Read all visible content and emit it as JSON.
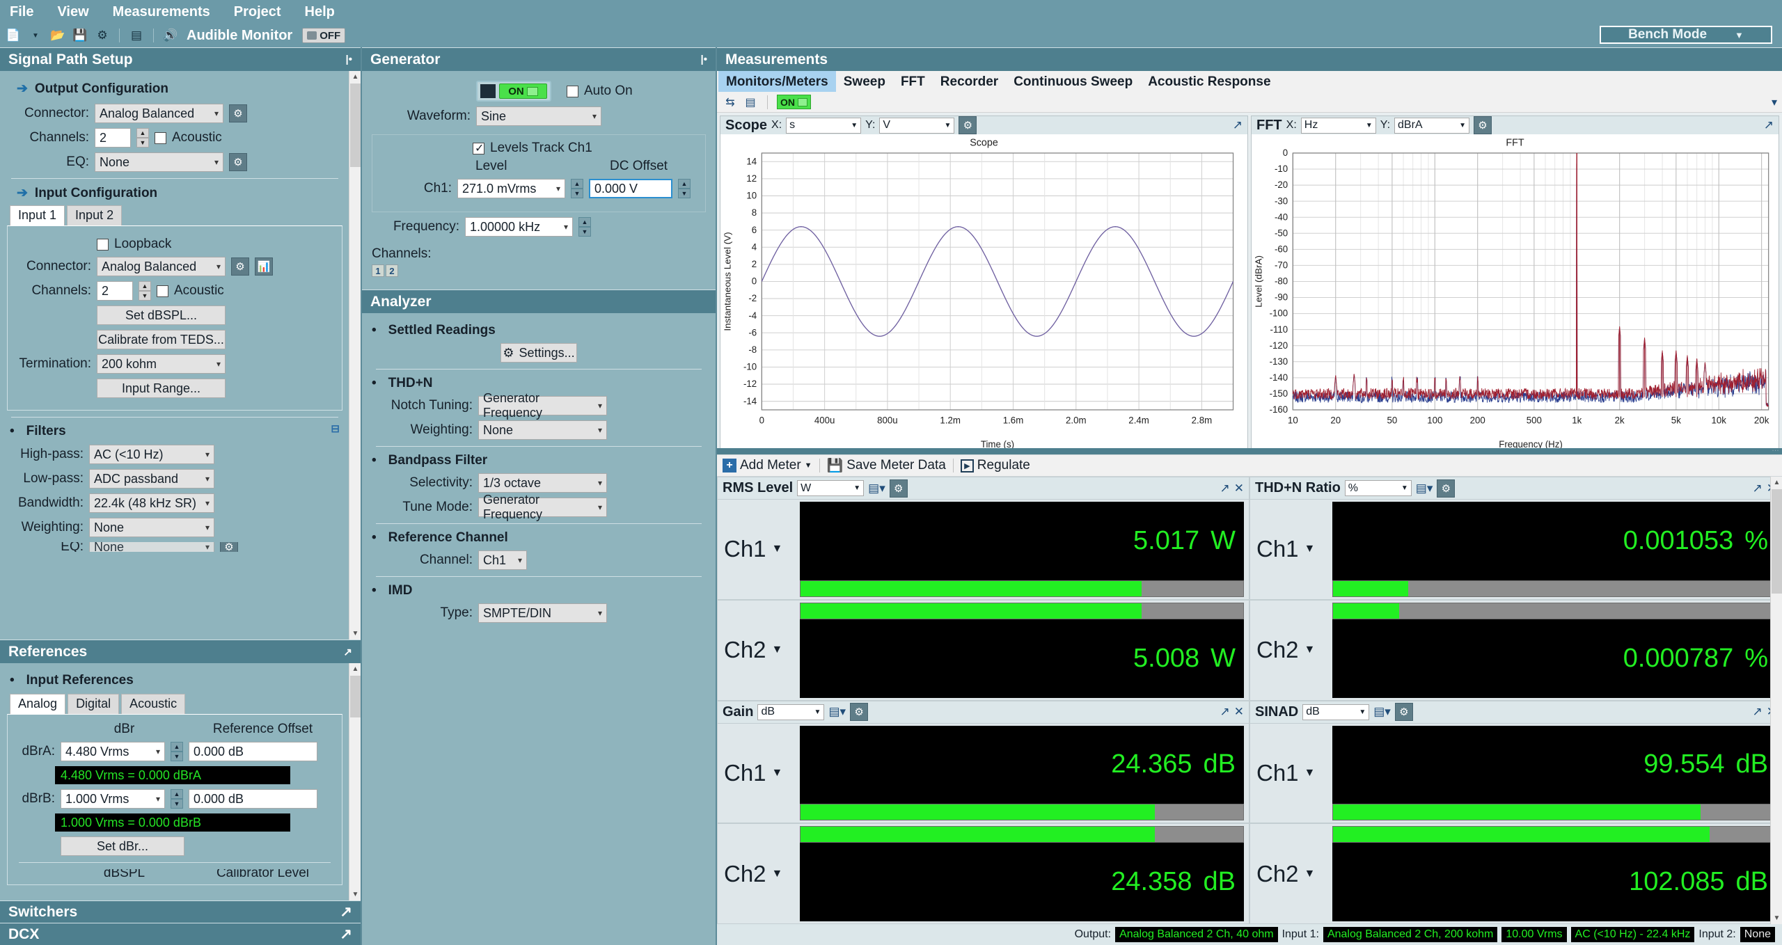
{
  "menu": {
    "items": [
      "File",
      "View",
      "Measurements",
      "Project",
      "Help"
    ]
  },
  "toolbar": {
    "icons": [
      "new-document-icon",
      "open-folder-icon",
      "save-icon",
      "settings-gear-icon",
      "waveform-icon",
      "speaker-icon"
    ],
    "audible_monitor_label": "Audible Monitor",
    "audible_monitor_state": "OFF",
    "bench_mode_label": "Bench Mode"
  },
  "signal_path": {
    "panel_title": "Signal Path Setup",
    "output": {
      "section_title": "Output Configuration",
      "connector_label": "Connector:",
      "connector_value": "Analog Balanced",
      "channels_label": "Channels:",
      "channels_value": "2",
      "acoustic_label": "Acoustic",
      "eq_label": "EQ:",
      "eq_value": "None"
    },
    "input": {
      "section_title": "Input Configuration",
      "tabs": [
        "Input 1",
        "Input 2"
      ],
      "active_tab": "Input 1",
      "loopback_label": "Loopback",
      "connector_label": "Connector:",
      "connector_value": "Analog Balanced",
      "channels_label": "Channels:",
      "channels_value": "2",
      "acoustic_label": "Acoustic",
      "set_dbspl_label": "Set dBSPL...",
      "calibrate_teds_label": "Calibrate from TEDS...",
      "termination_label": "Termination:",
      "termination_value": "200 kohm",
      "input_range_label": "Input Range..."
    },
    "filters": {
      "section_title": "Filters",
      "highpass_label": "High-pass:",
      "highpass_value": "AC (<10 Hz)",
      "lowpass_label": "Low-pass:",
      "lowpass_value": "ADC passband",
      "bandwidth_label": "Bandwidth:",
      "bandwidth_value": "22.4k (48 kHz SR)",
      "weighting_label": "Weighting:",
      "weighting_value": "None",
      "eq_label": "EQ:",
      "eq_value": "None"
    }
  },
  "references": {
    "panel_title": "References",
    "section_title": "Input References",
    "tabs": [
      "Analog",
      "Digital",
      "Acoustic"
    ],
    "active_tab": "Analog",
    "col_dbr": "dBr",
    "col_offset": "Reference Offset",
    "rows": [
      {
        "label": "dBrA:",
        "value": "4.480 Vrms",
        "offset": "0.000 dB",
        "readout": "4.480 Vrms = 0.000 dBrA"
      },
      {
        "label": "dBrB:",
        "value": "1.000 Vrms",
        "offset": "0.000 dB",
        "readout": "1.000 Vrms = 0.000 dBrB"
      }
    ],
    "set_dbr_label": "Set dBr...",
    "footer_col_dbspl": "dBSPL",
    "footer_col_calibrator": "Calibrator Level"
  },
  "bottom_panels": [
    {
      "title": "Switchers"
    },
    {
      "title": "DCX"
    }
  ],
  "generator": {
    "panel_title": "Generator",
    "on_label": "ON",
    "auto_on_label": "Auto On",
    "waveform_label": "Waveform:",
    "waveform_value": "Sine",
    "levels_track_label": "Levels Track Ch1",
    "level_col": "Level",
    "dc_offset_col": "DC Offset",
    "ch1_label": "Ch1:",
    "ch1_level": "271.0 mVrms",
    "ch1_dc_offset": "0.000 V",
    "frequency_label": "Frequency:",
    "frequency_value": "1.00000 kHz",
    "channels_label": "Channels:",
    "channel_buttons": [
      "1",
      "2"
    ]
  },
  "analyzer": {
    "panel_title": "Analyzer",
    "settled_readings_title": "Settled Readings",
    "settings_label": "Settings...",
    "thdn_title": "THD+N",
    "notch_tuning_label": "Notch Tuning:",
    "notch_tuning_value": "Generator Frequency",
    "weighting_label": "Weighting:",
    "weighting_value": "None",
    "bandpass_title": "Bandpass Filter",
    "selectivity_label": "Selectivity:",
    "selectivity_value": "1/3 octave",
    "tune_mode_label": "Tune Mode:",
    "tune_mode_value": "Generator Frequency",
    "reference_channel_title": "Reference Channel",
    "channel_label": "Channel:",
    "channel_value": "Ch1",
    "imd_title": "IMD",
    "type_label": "Type:",
    "type_value": "SMPTE/DIN"
  },
  "measurements": {
    "panel_title": "Measurements",
    "tabs": [
      "Monitors/Meters",
      "Sweep",
      "FFT",
      "Recorder",
      "Continuous Sweep",
      "Acoustic Response"
    ],
    "active_tab": "Monitors/Meters",
    "toolbar_on_label": "ON",
    "meter_toolbar": {
      "add_meter_label": "Add Meter",
      "save_meter_data_label": "Save Meter Data",
      "regulate_label": "Regulate"
    }
  },
  "chart_data": [
    {
      "type": "line",
      "name": "scope",
      "panel_name": "Scope",
      "x_axis_unit_label": "X:",
      "x_axis_unit": "s",
      "y_axis_unit_label": "Y:",
      "y_axis_unit": "V",
      "title": "Scope",
      "xlabel": "Time (s)",
      "ylabel": "Instantaneous Level (V)",
      "xlim": [
        0,
        0.003
      ],
      "ylim": [
        -15,
        15
      ],
      "xticks": [
        "0",
        "400u",
        "800u",
        "1.2m",
        "1.6m",
        "2.0m",
        "2.4m",
        "2.8m"
      ],
      "xtick_values": [
        0,
        0.0004,
        0.0008,
        0.0012,
        0.0016,
        0.002,
        0.0024,
        0.0028
      ],
      "yticks": [
        14,
        12,
        10,
        8,
        6,
        4,
        2,
        0,
        -2,
        -4,
        -6,
        -8,
        -10,
        -12,
        -14
      ],
      "grid": true,
      "series": [
        {
          "name": "Ch1",
          "color": "#6e5fa0",
          "waveform": "sine",
          "amplitude": 6.4,
          "frequency_hz": 1000,
          "phase_deg": 0
        }
      ]
    },
    {
      "type": "line",
      "name": "fft",
      "panel_name": "FFT",
      "x_axis_unit_label": "X:",
      "x_axis_unit": "Hz",
      "y_axis_unit_label": "Y:",
      "y_axis_unit": "dBrA",
      "title": "FFT",
      "xlabel": "Frequency (Hz)",
      "ylabel": "Level (dBrA)",
      "xscale": "log",
      "xlim": [
        10,
        22400
      ],
      "ylim": [
        -160,
        0
      ],
      "xticks": [
        "10",
        "20",
        "50",
        "100",
        "200",
        "500",
        "1k",
        "2k",
        "5k",
        "10k",
        "20k"
      ],
      "xtick_values": [
        10,
        20,
        50,
        100,
        200,
        500,
        1000,
        2000,
        5000,
        10000,
        20000
      ],
      "yticks": [
        0,
        -10,
        -20,
        -30,
        -40,
        -50,
        -60,
        -70,
        -80,
        -90,
        -100,
        -110,
        -120,
        -130,
        -140,
        -150,
        -160
      ],
      "grid": true,
      "series": [
        {
          "name": "Ch1",
          "color": "#a02030",
          "noise_floor_db": -150,
          "fundamental_hz": 1000,
          "fundamental_db": 0
        },
        {
          "name": "Ch2",
          "color": "#2b3f8f",
          "noise_floor_db": -151,
          "fundamental_hz": 1000,
          "fundamental_db": 0
        }
      ],
      "peaks": [
        {
          "hz": 1000,
          "db": 0
        },
        {
          "hz": 2000,
          "db": -108
        },
        {
          "hz": 3000,
          "db": -115
        },
        {
          "hz": 4000,
          "db": -123
        },
        {
          "hz": 5000,
          "db": -123
        },
        {
          "hz": 6000,
          "db": -126
        },
        {
          "hz": 7000,
          "db": -128
        },
        {
          "hz": 8000,
          "db": -130
        },
        {
          "hz": 20,
          "db": -138
        },
        {
          "hz": 27,
          "db": -137
        }
      ]
    }
  ],
  "meters": [
    {
      "title": "RMS Level",
      "unit": "W",
      "rows": [
        {
          "channel": "Ch1",
          "value": "5.017",
          "unit": "W",
          "bar_pct": 77
        },
        {
          "channel": "Ch2",
          "value": "5.008",
          "unit": "W",
          "bar_pct": 77
        }
      ]
    },
    {
      "title": "THD+N Ratio",
      "unit": "%",
      "rows": [
        {
          "channel": "Ch1",
          "value": "0.001053",
          "unit": "%",
          "bar_pct": 17
        },
        {
          "channel": "Ch2",
          "value": "0.000787",
          "unit": "%",
          "bar_pct": 15
        }
      ]
    },
    {
      "title": "Gain",
      "unit": "dB",
      "rows": [
        {
          "channel": "Ch1",
          "value": "24.365",
          "unit": "dB",
          "bar_pct": 80
        },
        {
          "channel": "Ch2",
          "value": "24.358",
          "unit": "dB",
          "bar_pct": 80
        }
      ]
    },
    {
      "title": "SINAD",
      "unit": "dB",
      "rows": [
        {
          "channel": "Ch1",
          "value": "99.554",
          "unit": "dB",
          "bar_pct": 83
        },
        {
          "channel": "Ch2",
          "value": "102.085",
          "unit": "dB",
          "bar_pct": 85
        }
      ]
    }
  ],
  "statusbar": {
    "output_label": "Output:",
    "output_value": "Analog Balanced 2 Ch, 40 ohm",
    "input1_label": "Input 1:",
    "input1_value": "Analog Balanced 2 Ch, 200 kohm",
    "input1_level": "10.00 Vrms",
    "input1_filter": "AC (<10 Hz) - 22.4 kHz",
    "input2_label": "Input 2:",
    "input2_value": "None"
  }
}
